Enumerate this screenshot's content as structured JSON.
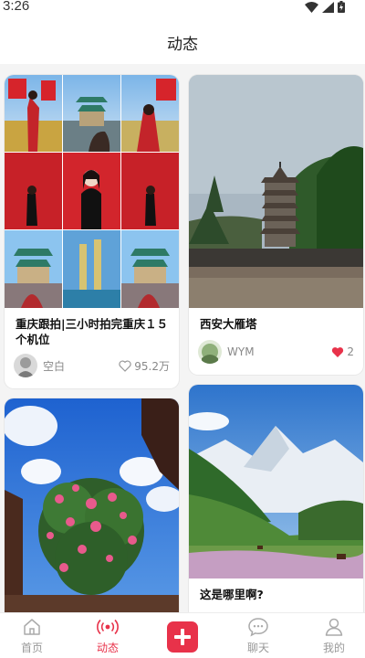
{
  "status": {
    "time": "3:26"
  },
  "header": {
    "title": "动态"
  },
  "posts": [
    {
      "title": "重庆跟拍|三小时拍完重庆１５个机位",
      "author": "空白",
      "likes": "95.2万",
      "liked": false
    },
    {
      "title": "西安大雁塔",
      "author": "WYM",
      "likes": "2",
      "liked": true
    },
    {
      "title": "",
      "author": "",
      "likes": ""
    },
    {
      "title": "这是哪里啊?",
      "author": "",
      "likes": ""
    }
  ],
  "tabbar": {
    "items": [
      {
        "label": "首页",
        "icon": "home-icon"
      },
      {
        "label": "动态",
        "icon": "broadcast-icon",
        "active": true
      },
      {
        "label": "",
        "icon": "plus-icon"
      },
      {
        "label": "聊天",
        "icon": "chat-bubble-icon"
      },
      {
        "label": "我的",
        "icon": "person-icon"
      }
    ]
  },
  "colors": {
    "accent": "#e8324a",
    "like_red": "#e8324a"
  }
}
